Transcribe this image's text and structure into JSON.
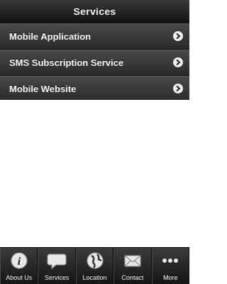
{
  "header": {
    "title": "Services"
  },
  "menu": {
    "items": [
      {
        "label": "Mobile Application"
      },
      {
        "label": "SMS Subscription Service"
      },
      {
        "label": "Mobile Website"
      }
    ]
  },
  "tabbar": {
    "tabs": [
      {
        "label": "About Us",
        "icon": "info-icon"
      },
      {
        "label": "Services",
        "icon": "speech-bubble-icon"
      },
      {
        "label": "Location",
        "icon": "globe-icon"
      },
      {
        "label": "Contact",
        "icon": "envelope-icon"
      },
      {
        "label": "More",
        "icon": "more-dots-icon"
      }
    ]
  }
}
